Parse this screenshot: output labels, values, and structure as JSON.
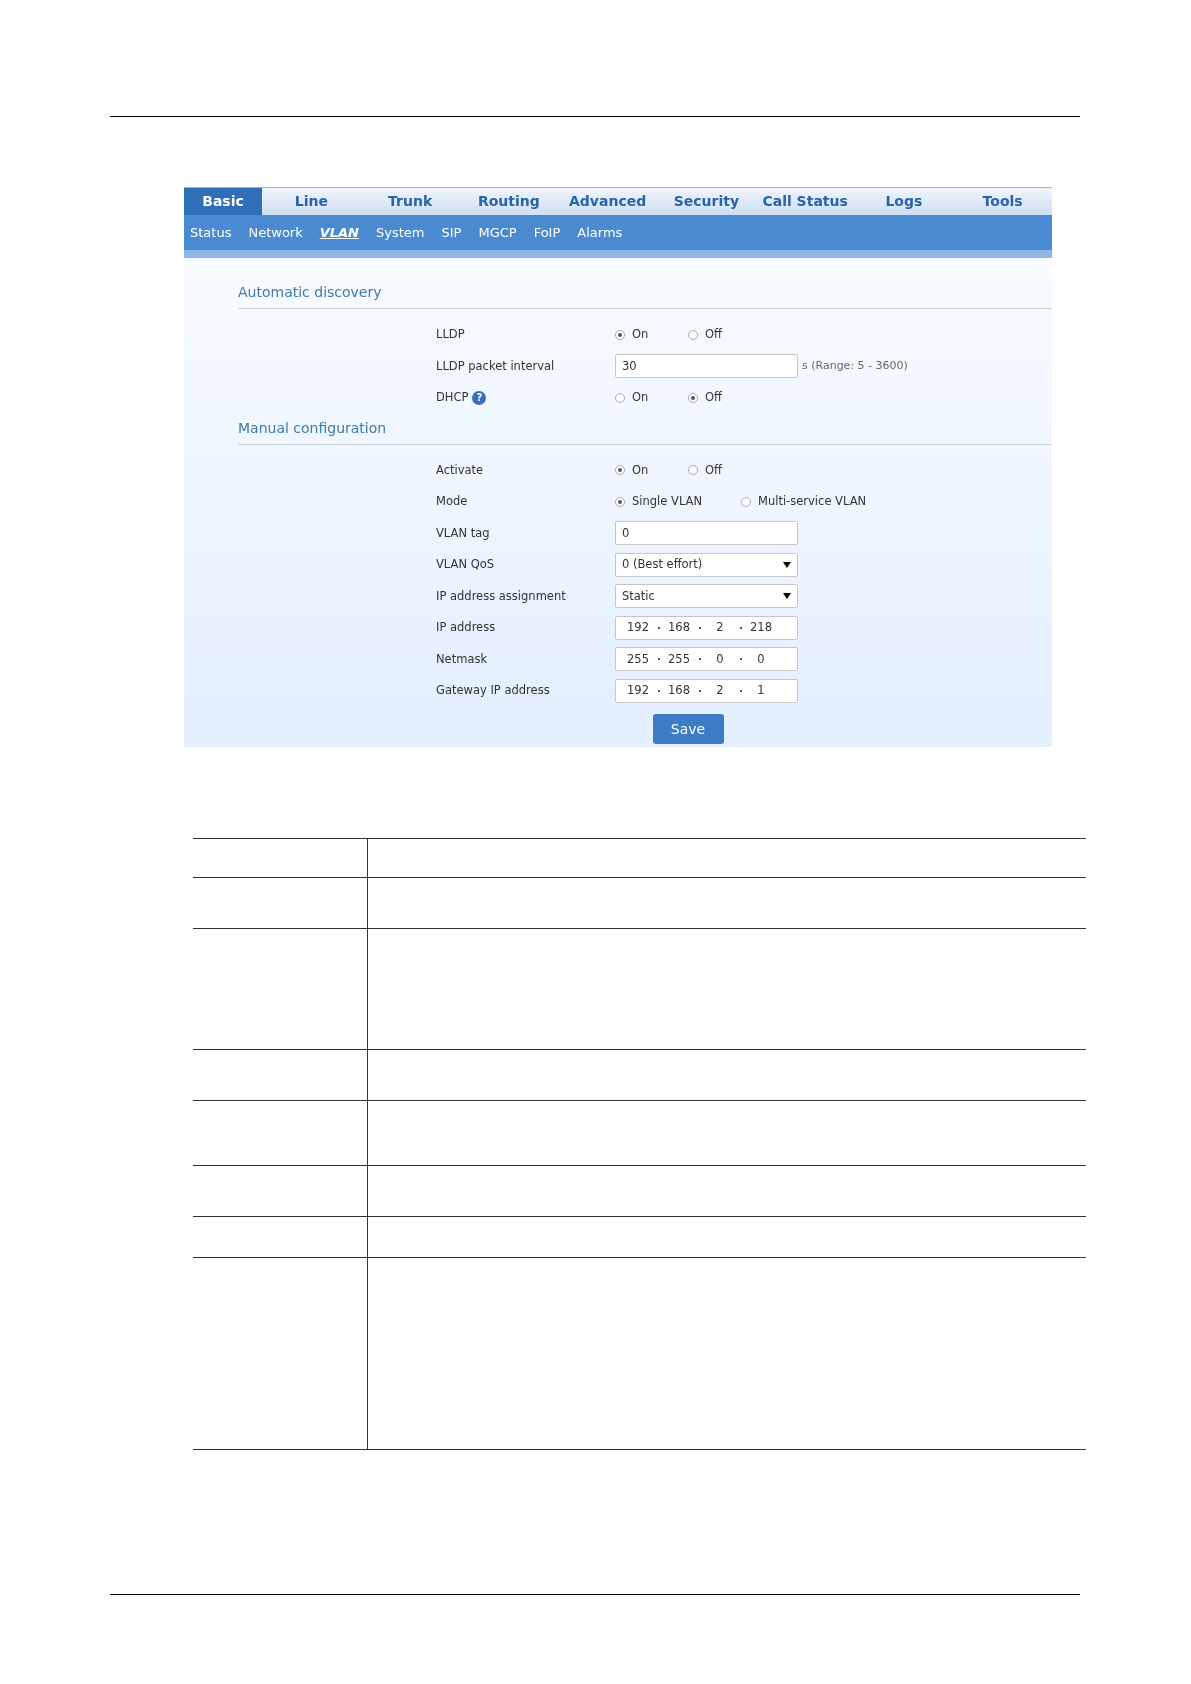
{
  "tabs": [
    {
      "label": "Basic",
      "selected": true
    },
    {
      "label": "Line",
      "selected": false
    },
    {
      "label": "Trunk",
      "selected": false
    },
    {
      "label": "Routing",
      "selected": false
    },
    {
      "label": "Advanced",
      "selected": false
    },
    {
      "label": "Security",
      "selected": false
    },
    {
      "label": "Call Status",
      "selected": false
    },
    {
      "label": "Logs",
      "selected": false
    },
    {
      "label": "Tools",
      "selected": false
    }
  ],
  "subtabs": [
    {
      "label": "Status",
      "selected": false
    },
    {
      "label": "Network",
      "selected": false
    },
    {
      "label": "VLAN",
      "selected": true
    },
    {
      "label": "System",
      "selected": false
    },
    {
      "label": "SIP",
      "selected": false
    },
    {
      "label": "MGCP",
      "selected": false
    },
    {
      "label": "FoIP",
      "selected": false
    },
    {
      "label": "Alarms",
      "selected": false
    }
  ],
  "sections": [
    {
      "title": "Automatic discovery",
      "rows": [
        {
          "kind": "radio",
          "label": "LLDP",
          "options": [
            {
              "label": "On",
              "selected": true
            },
            {
              "label": "Off",
              "selected": false
            }
          ]
        },
        {
          "kind": "text",
          "label": "LLDP packet interval",
          "value": "30",
          "suffix": "s (Range: 5 - 3600)"
        },
        {
          "kind": "radio",
          "label": "DHCP",
          "help": "?",
          "options": [
            {
              "label": "On",
              "selected": false
            },
            {
              "label": "Off",
              "selected": true
            }
          ]
        }
      ]
    },
    {
      "title": "Manual configuration",
      "rows": [
        {
          "kind": "radio",
          "label": "Activate",
          "options": [
            {
              "label": "On",
              "selected": true
            },
            {
              "label": "Off",
              "selected": false
            }
          ]
        },
        {
          "kind": "radio",
          "label": "Mode",
          "options": [
            {
              "label": "Single VLAN",
              "selected": true
            },
            {
              "label": "Multi-service VLAN",
              "selected": false
            }
          ]
        },
        {
          "kind": "text",
          "label": "VLAN tag",
          "value": "0"
        },
        {
          "kind": "select",
          "label": "VLAN QoS",
          "value": "0 (Best effort)"
        },
        {
          "kind": "select",
          "label": "IP address assignment",
          "value": "Static"
        },
        {
          "kind": "ip",
          "label": "IP address",
          "octets": [
            "192",
            "168",
            "2",
            "218"
          ]
        },
        {
          "kind": "ip",
          "label": "Netmask",
          "octets": [
            "255",
            "255",
            "0",
            "0"
          ]
        },
        {
          "kind": "ip",
          "label": "Gateway IP address",
          "octets": [
            "192",
            "168",
            "2",
            "1"
          ]
        }
      ]
    }
  ],
  "save_button": "Save"
}
